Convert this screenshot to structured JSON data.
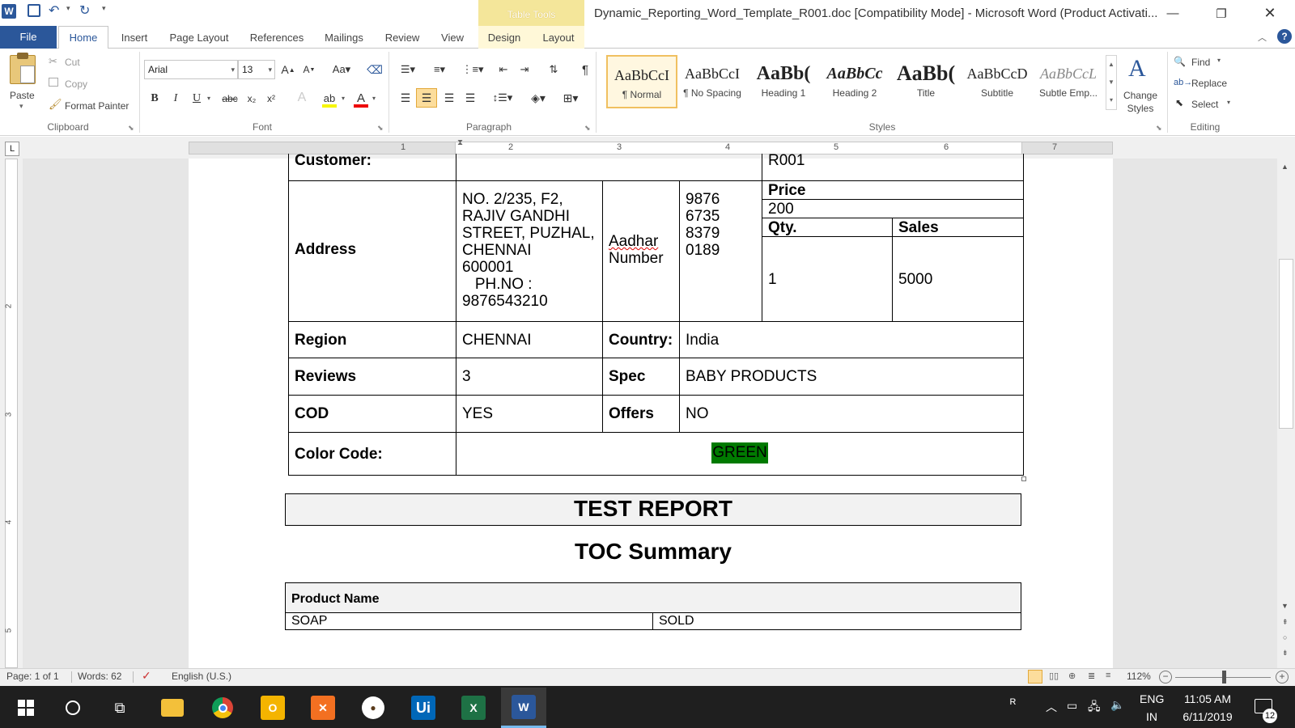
{
  "app": {
    "title": "Dynamic_Reporting_Word_Template_R001.doc [Compatibility Mode]  -  Microsoft Word (Product Activati...",
    "contextual_group": "Table Tools"
  },
  "tabs": [
    "File",
    "Home",
    "Insert",
    "Page Layout",
    "References",
    "Mailings",
    "Review",
    "View",
    "Design",
    "Layout"
  ],
  "clipboard": {
    "paste": "Paste",
    "cut": "Cut",
    "copy": "Copy",
    "format_painter": "Format Painter",
    "label": "Clipboard"
  },
  "font": {
    "name": "Arial",
    "size": "13",
    "label": "Font"
  },
  "paragraph": {
    "label": "Paragraph"
  },
  "styles": {
    "items": [
      {
        "sample": "AaBbCcI",
        "name": "¶ Normal"
      },
      {
        "sample": "AaBbCcI",
        "name": "¶ No Spacing"
      },
      {
        "sample": "AaBb(",
        "name": "Heading 1"
      },
      {
        "sample": "AaBbCc",
        "name": "Heading 2"
      },
      {
        "sample": "AaBb(",
        "name": "Title"
      },
      {
        "sample": "AaBbCcD",
        "name": "Subtitle"
      },
      {
        "sample": "AaBbCcL",
        "name": "Subtle Emp..."
      }
    ],
    "change_styles": "Change Styles",
    "label": "Styles"
  },
  "editing": {
    "find": "Find",
    "replace": "Replace",
    "select": "Select",
    "label": "Editing"
  },
  "ruler": {
    "numbers": [
      "1",
      "2",
      "3",
      "4",
      "5",
      "6",
      "7"
    ],
    "vnumbers": [
      "2",
      "3",
      "4",
      "5"
    ]
  },
  "table": {
    "customer_label": "Customer:",
    "customer_value": "R001",
    "address_label": "Address",
    "address_lines": [
      "NO. 2/235, F2,",
      "RAJIV GANDHI",
      "STREET, PUZHAL,",
      "CHENNAI",
      "600001",
      "   PH.NO :",
      "9876543210"
    ],
    "aadhar_label_1": "Aadhar",
    "aadhar_label_2": "Number",
    "aadhar_lines": [
      "9876",
      "6735",
      "8379",
      "0189"
    ],
    "price_label": "Price",
    "price_value": "200",
    "qty_label": "Qty.",
    "sales_label": "Sales",
    "qty_value": "1",
    "sales_value": "5000",
    "region_label": "Region",
    "region_value": "CHENNAI",
    "country_label": "Country:",
    "country_value": "India",
    "reviews_label": "Reviews",
    "reviews_value": "3",
    "spec_label": "Spec",
    "spec_value": "BABY PRODUCTS",
    "cod_label": "COD",
    "cod_value": "YES",
    "offers_label": "Offers",
    "offers_value": "NO",
    "color_label": "Color Code:",
    "color_value": "GREEN",
    "color_highlight": "#007a00"
  },
  "report": {
    "title": "TEST REPORT",
    "toc": "TOC Summary",
    "col_header": "Product Name",
    "row_product": "SOAP",
    "row_status": "SOLD"
  },
  "status": {
    "page": "Page: 1 of 1",
    "words": "Words: 62",
    "language": "English (U.S.)",
    "zoom": "112%"
  },
  "tray": {
    "lang1": "ENG",
    "lang2": "IN",
    "time": "11:05 AM",
    "date": "6/11/2019",
    "notif": "12"
  },
  "colors": {
    "accent": "#2b579a",
    "table_tools": "#f4e69a"
  }
}
